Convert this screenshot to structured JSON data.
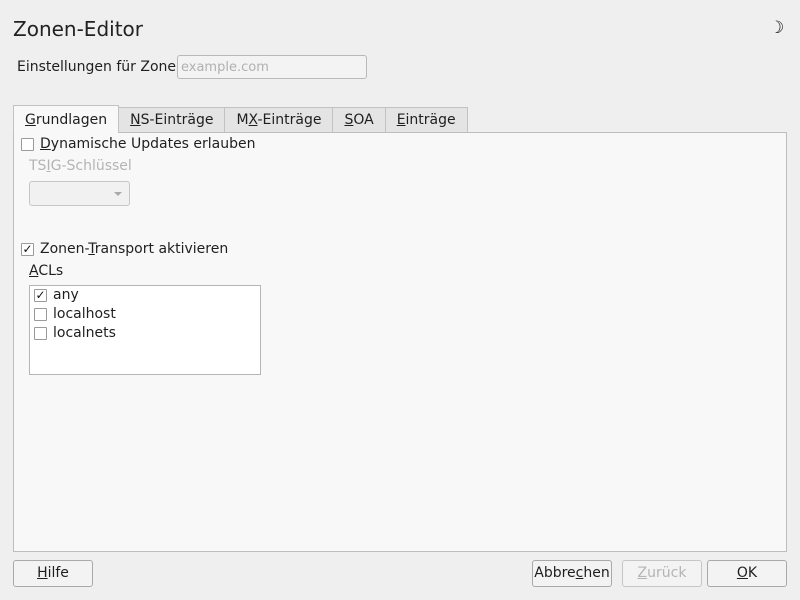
{
  "window": {
    "title": "Zonen-Editor",
    "corner_icon": "moon-icon"
  },
  "zone": {
    "label": "Einstellungen für Zone",
    "placeholder": "example.com",
    "value": ""
  },
  "tabs": [
    {
      "pre": "",
      "u": "G",
      "post": "rundlagen",
      "active": true
    },
    {
      "pre": "",
      "u": "N",
      "post": "S-Einträge",
      "active": false
    },
    {
      "pre": "M",
      "u": "X",
      "post": "-Einträge",
      "active": false
    },
    {
      "pre": "",
      "u": "S",
      "post": "OA",
      "active": false
    },
    {
      "pre": "",
      "u": "E",
      "post": "inträge",
      "active": false
    }
  ],
  "basics": {
    "dynamic_updates": {
      "pre": "",
      "u": "D",
      "post": "ynamische Updates erlauben",
      "checked": false
    },
    "tsig": {
      "pre": "TS",
      "u": "I",
      "post": "G-Schlüssel",
      "value": ""
    },
    "zone_transport": {
      "pre": "Zonen-",
      "u": "T",
      "post": "ransport aktivieren",
      "checked": true
    },
    "acls_label": {
      "pre": "",
      "u": "A",
      "post": "CLs"
    },
    "acls": [
      {
        "label": "any",
        "checked": true
      },
      {
        "label": "localhost",
        "checked": false
      },
      {
        "label": "localnets",
        "checked": false
      }
    ]
  },
  "buttons": {
    "help": {
      "pre": "",
      "u": "H",
      "post": "ilfe"
    },
    "cancel": {
      "pre": "Abbre",
      "u": "c",
      "post": "hen"
    },
    "back": {
      "pre": "",
      "u": "Z",
      "post": "urück"
    },
    "ok": {
      "pre": "",
      "u": "O",
      "post": "K"
    }
  },
  "check_mark": "✓"
}
